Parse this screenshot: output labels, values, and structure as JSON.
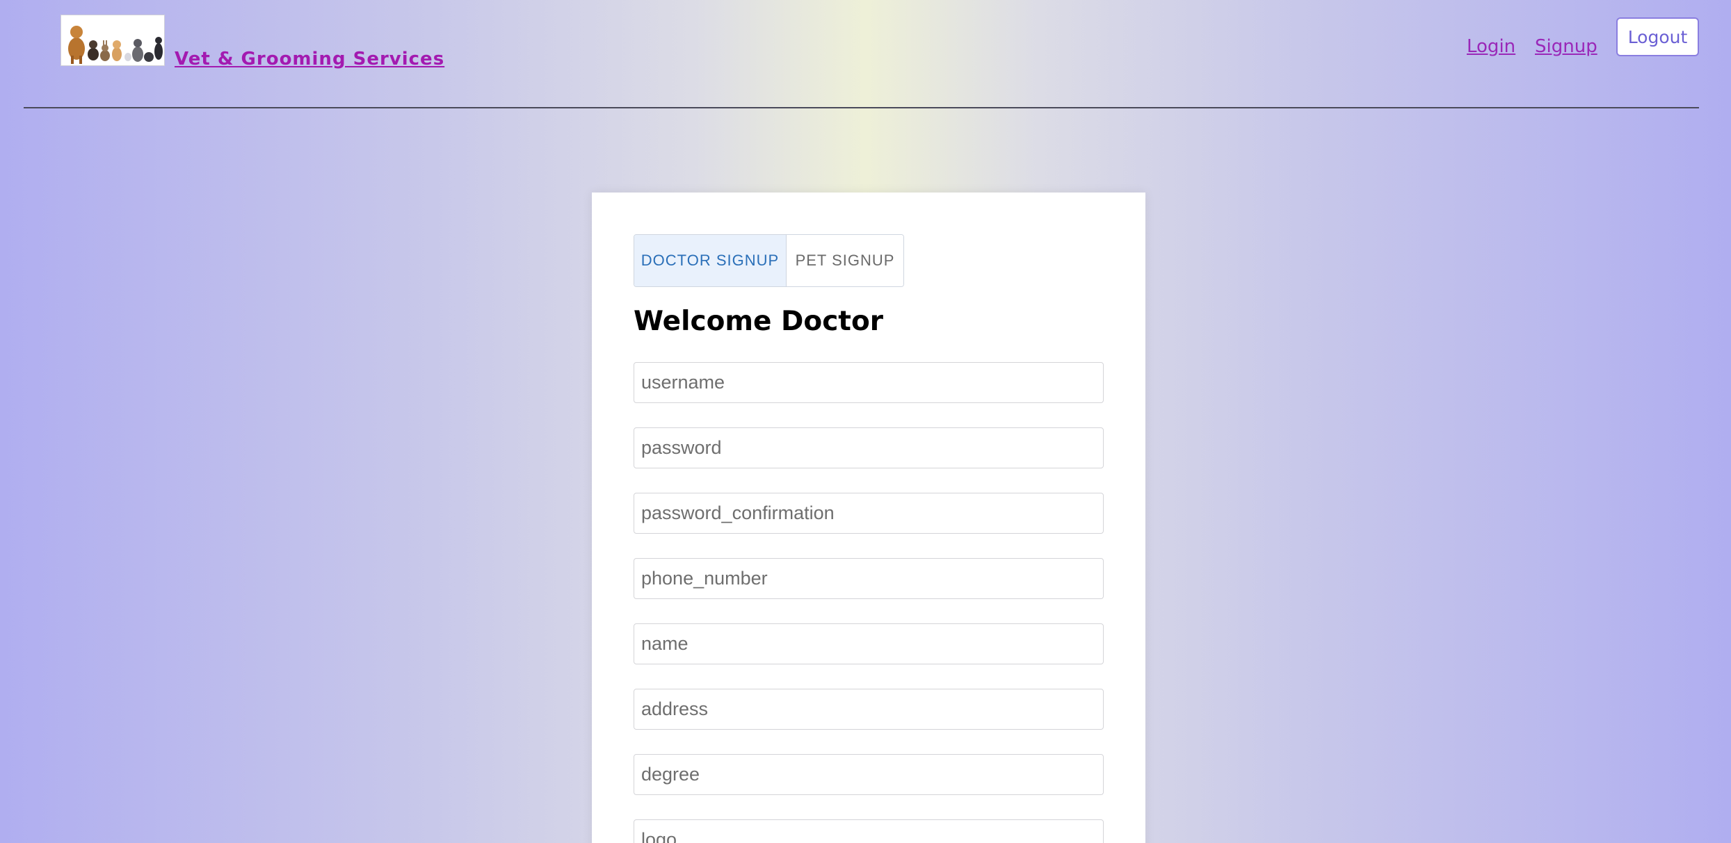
{
  "header": {
    "brand": "Vet & Grooming Services",
    "logo_alt": "pets-logo",
    "nav": {
      "login": "Login",
      "signup": "Signup",
      "logout": "Logout"
    }
  },
  "card": {
    "tabs": {
      "doctor": "DOCTOR SIGNUP",
      "pet": "PET SIGNUP",
      "active": "DOCTOR SIGNUP"
    },
    "title": "Welcome Doctor",
    "fields": {
      "username": "username",
      "password": "password",
      "password_confirmation": "password_confirmation",
      "phone_number": "phone_number",
      "name": "name",
      "address": "address",
      "degree": "degree",
      "logo": "logo"
    }
  },
  "colors": {
    "brand": "#a31ab0",
    "active_tab_text": "#2a6fb8",
    "logout_text": "#6a5fd4"
  }
}
